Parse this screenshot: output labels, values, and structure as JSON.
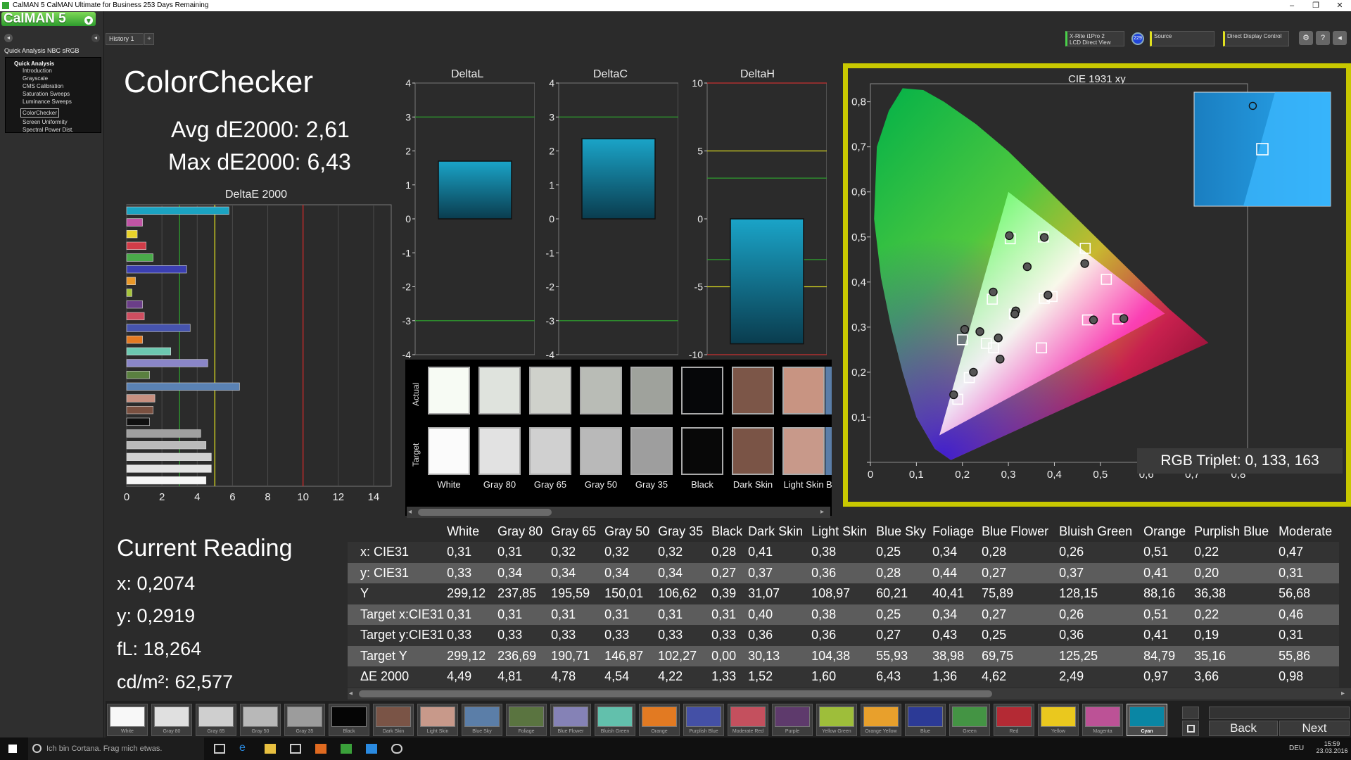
{
  "window": {
    "title": "CalMAN 5 CalMAN Ultimate for Business 253 Days Remaining"
  },
  "logo": "CalMAN 5",
  "nav": {
    "workflow": "Quick Analysis NBC sRGB",
    "header": "Quick Analysis",
    "items": [
      "Introduction",
      "Grayscale",
      "CMS Calibration",
      "Saturation Sweeps",
      "Luminance Sweeps",
      "ColorChecker",
      "Screen Uniformity",
      "Spectral Power Dist."
    ],
    "selected": 5
  },
  "history_tab": "History 1",
  "devices": {
    "meter_line1": "X-Rite i1Pro 2",
    "meter_line2": "LCD Direct View",
    "meter_badge": "229",
    "source": "Source",
    "display": "Direct Display Control"
  },
  "colorchecker": {
    "title": "ColorChecker",
    "avg": "Avg dE2000: 2,61",
    "max": "Max dE2000: 6,43"
  },
  "deltae_chart": {
    "title": "DeltaE 2000",
    "ticks": [
      "0",
      "2",
      "4",
      "6",
      "8",
      "10",
      "12",
      "14"
    ],
    "xmax": 15,
    "green_line": 3,
    "yellow_line": 5,
    "red_line": 10,
    "bars": [
      {
        "v": 5.8,
        "c": "#1ba3c2"
      },
      {
        "v": 0.9,
        "c": "#c054a4"
      },
      {
        "v": 0.6,
        "c": "#e8d22a"
      },
      {
        "v": 1.1,
        "c": "#d13c48"
      },
      {
        "v": 1.5,
        "c": "#4aaa4a"
      },
      {
        "v": 3.4,
        "c": "#3b3fb2"
      },
      {
        "v": 0.5,
        "c": "#ea9828"
      },
      {
        "v": 0.3,
        "c": "#a6c43a"
      },
      {
        "v": 0.9,
        "c": "#6b3e88"
      },
      {
        "v": 1.0,
        "c": "#cf4e60"
      },
      {
        "v": 3.6,
        "c": "#4654ae"
      },
      {
        "v": 0.9,
        "c": "#e47a22"
      },
      {
        "v": 2.5,
        "c": "#6cc8b0"
      },
      {
        "v": 4.6,
        "c": "#8a86c8"
      },
      {
        "v": 1.3,
        "c": "#5a8040"
      },
      {
        "v": 6.4,
        "c": "#5a82b4"
      },
      {
        "v": 1.6,
        "c": "#c89080"
      },
      {
        "v": 1.5,
        "c": "#7a5040"
      },
      {
        "v": 1.3,
        "c": "#101010"
      },
      {
        "v": 4.2,
        "c": "#a0a0a0"
      },
      {
        "v": 4.5,
        "c": "#bababa"
      },
      {
        "v": 4.8,
        "c": "#d0d0d0"
      },
      {
        "v": 4.8,
        "c": "#e4e4e4"
      },
      {
        "v": 4.5,
        "c": "#f6f6f6"
      }
    ]
  },
  "delta_charts": [
    {
      "title": "DeltaL",
      "ticks": [
        "4",
        "3",
        "2",
        "1",
        "0",
        "-1",
        "-2",
        "-3",
        "-4"
      ],
      "min": -4,
      "max": 4,
      "lines": [
        {
          "v": 3,
          "c": "#2e9c2e"
        },
        {
          "v": -3,
          "c": "#2e9c2e"
        }
      ],
      "value": 1.7
    },
    {
      "title": "DeltaC",
      "ticks": [
        "4",
        "3",
        "2",
        "1",
        "0",
        "-1",
        "-2",
        "-3",
        "-4"
      ],
      "min": -4,
      "max": 4,
      "lines": [
        {
          "v": 3,
          "c": "#2e9c2e"
        },
        {
          "v": -3,
          "c": "#2e9c2e"
        }
      ],
      "value": 2.36
    },
    {
      "title": "DeltaH",
      "ticks": [
        "10",
        "5",
        "0",
        "-5",
        "-10"
      ],
      "min": -10,
      "max": 10,
      "lines": [
        {
          "v": 10,
          "c": "#c83030"
        },
        {
          "v": 5,
          "c": "#d8d820"
        },
        {
          "v": 3,
          "c": "#2e9c2e"
        },
        {
          "v": -3,
          "c": "#2e9c2e"
        },
        {
          "v": -5,
          "c": "#d8d820"
        },
        {
          "v": -10,
          "c": "#c83030"
        }
      ],
      "value": -9.2
    }
  ],
  "swatch_panel": {
    "actual_label": "Actual",
    "target_label": "Target",
    "patches": [
      {
        "name": "White",
        "actual": "#f7fbf4",
        "target": "#fbfbfb"
      },
      {
        "name": "Gray 80",
        "actual": "#dfe3dd",
        "target": "#e2e2e2"
      },
      {
        "name": "Gray 65",
        "actual": "#cfd1cb",
        "target": "#d0d0d0"
      },
      {
        "name": "Gray 50",
        "actual": "#b9bcb6",
        "target": "#b9b9b9"
      },
      {
        "name": "Gray 35",
        "actual": "#9fa29c",
        "target": "#9e9e9e"
      },
      {
        "name": "Black",
        "actual": "#060709",
        "target": "#080808"
      },
      {
        "name": "Dark Skin",
        "actual": "#7c5648",
        "target": "#7a5446"
      },
      {
        "name": "Light Skin",
        "actual": "#c89482",
        "target": "#c8998a"
      }
    ],
    "partial_label": "B"
  },
  "cie": {
    "title": "CIE 1931 xy",
    "x_ticks": [
      "0",
      "0,1",
      "0,2",
      "0,3",
      "0,4",
      "0,5",
      "0,6",
      "0,7",
      "0,8"
    ],
    "y_ticks": [
      "0,8",
      "0,7",
      "0,6",
      "0,5",
      "0,4",
      "0,3",
      "0,2",
      "0,1",
      "0"
    ],
    "gamut": [
      [
        0.64,
        0.33
      ],
      [
        0.3,
        0.6
      ],
      [
        0.15,
        0.06
      ]
    ],
    "measured": [
      [
        0.302,
        0.503
      ],
      [
        0.378,
        0.499
      ],
      [
        0.341,
        0.434
      ],
      [
        0.466,
        0.441
      ],
      [
        0.267,
        0.378
      ],
      [
        0.386,
        0.371
      ],
      [
        0.316,
        0.336
      ],
      [
        0.224,
        0.2
      ],
      [
        0.238,
        0.29
      ],
      [
        0.278,
        0.276
      ],
      [
        0.314,
        0.329
      ],
      [
        0.282,
        0.229
      ],
      [
        0.205,
        0.295
      ],
      [
        0.181,
        0.15
      ],
      [
        0.485,
        0.316
      ],
      [
        0.551,
        0.319
      ]
    ],
    "targets": [
      [
        0.304,
        0.496
      ],
      [
        0.376,
        0.5
      ],
      [
        0.467,
        0.475
      ],
      [
        0.513,
        0.406
      ],
      [
        0.265,
        0.362
      ],
      [
        0.378,
        0.364
      ],
      [
        0.313,
        0.329
      ],
      [
        0.215,
        0.188
      ],
      [
        0.2,
        0.272
      ],
      [
        0.252,
        0.264
      ],
      [
        0.268,
        0.254
      ],
      [
        0.372,
        0.254
      ],
      [
        0.472,
        0.316
      ],
      [
        0.538,
        0.318
      ],
      [
        0.395,
        0.368
      ],
      [
        0.19,
        0.14
      ]
    ],
    "zoom_points": {
      "measured": [
        0.43,
        0.12
      ],
      "target": [
        0.5,
        0.5
      ]
    },
    "triplet": "RGB Triplet: 0, 133, 163"
  },
  "current_reading": {
    "title": "Current Reading",
    "x": "x: 0,2074",
    "y": "y: 0,2919",
    "fl": "fL: 18,264",
    "cdm2": "cd/m²: 62,577"
  },
  "table": {
    "columns": [
      "",
      "White",
      "Gray 80",
      "Gray 65",
      "Gray 50",
      "Gray 35",
      "Black",
      "Dark Skin",
      "Light Skin",
      "Blue Sky",
      "Foliage",
      "Blue Flower",
      "Bluish Green",
      "Orange",
      "Purplish Blue",
      "Moderate"
    ],
    "rows": [
      [
        "x: CIE31",
        "0,31",
        "0,31",
        "0,32",
        "0,32",
        "0,32",
        "0,28",
        "0,41",
        "0,38",
        "0,25",
        "0,34",
        "0,28",
        "0,26",
        "0,51",
        "0,22",
        "0,47"
      ],
      [
        "y: CIE31",
        "0,33",
        "0,34",
        "0,34",
        "0,34",
        "0,34",
        "0,27",
        "0,37",
        "0,36",
        "0,28",
        "0,44",
        "0,27",
        "0,37",
        "0,41",
        "0,20",
        "0,31"
      ],
      [
        "Y",
        "299,12",
        "237,85",
        "195,59",
        "150,01",
        "106,62",
        "0,39",
        "31,07",
        "108,97",
        "60,21",
        "40,41",
        "75,89",
        "128,15",
        "88,16",
        "36,38",
        "56,68"
      ],
      [
        "Target x:CIE31",
        "0,31",
        "0,31",
        "0,31",
        "0,31",
        "0,31",
        "0,31",
        "0,40",
        "0,38",
        "0,25",
        "0,34",
        "0,27",
        "0,26",
        "0,51",
        "0,22",
        "0,46"
      ],
      [
        "Target y:CIE31",
        "0,33",
        "0,33",
        "0,33",
        "0,33",
        "0,33",
        "0,33",
        "0,36",
        "0,36",
        "0,27",
        "0,43",
        "0,25",
        "0,36",
        "0,41",
        "0,19",
        "0,31"
      ],
      [
        "Target Y",
        "299,12",
        "236,69",
        "190,71",
        "146,87",
        "102,27",
        "0,00",
        "30,13",
        "104,38",
        "55,93",
        "38,98",
        "69,75",
        "125,25",
        "84,79",
        "35,16",
        "55,86"
      ],
      [
        "ΔE 2000",
        "4,49",
        "4,81",
        "4,78",
        "4,54",
        "4,22",
        "1,33",
        "1,52",
        "1,60",
        "6,43",
        "1,36",
        "4,62",
        "2,49",
        "0,97",
        "3,66",
        "0,98"
      ]
    ]
  },
  "bottom_swatches": [
    {
      "name": "White",
      "color": "#f8f8f8"
    },
    {
      "name": "Gray 80",
      "color": "#e0e0e0"
    },
    {
      "name": "Gray 65",
      "color": "#cfcfcf"
    },
    {
      "name": "Gray 50",
      "color": "#b8b8b8"
    },
    {
      "name": "Gray 35",
      "color": "#9c9c9c"
    },
    {
      "name": "Black",
      "color": "#050505"
    },
    {
      "name": "Dark Skin",
      "color": "#7a5446"
    },
    {
      "name": "Light Skin",
      "color": "#c8998a"
    },
    {
      "name": "Blue Sky",
      "color": "#5b7ea8"
    },
    {
      "name": "Foliage",
      "color": "#5a7440"
    },
    {
      "name": "Blue Flower",
      "color": "#8582b6"
    },
    {
      "name": "Bluish Green",
      "color": "#62c0ac"
    },
    {
      "name": "Orange",
      "color": "#e27a22"
    },
    {
      "name": "Purplish Blue",
      "color": "#4450a6"
    },
    {
      "name": "Moderate Red",
      "color": "#c4505e"
    },
    {
      "name": "Purple",
      "color": "#5e3a6c"
    },
    {
      "name": "Yellow Green",
      "color": "#9ebe3a"
    },
    {
      "name": "Orange Yellow",
      "color": "#e8a02c"
    },
    {
      "name": "Blue",
      "color": "#2c3a96"
    },
    {
      "name": "Green",
      "color": "#449444"
    },
    {
      "name": "Red",
      "color": "#b42a34"
    },
    {
      "name": "Yellow",
      "color": "#eac81e"
    },
    {
      "name": "Magenta",
      "color": "#bc5296"
    },
    {
      "name": "Cyan",
      "color": "#0a86a4"
    }
  ],
  "bottom_selected": 23,
  "nav_buttons": {
    "back": "Back",
    "next": "Next"
  },
  "taskbar": {
    "search": "Ich bin Cortana. Frag mich etwas.",
    "lang": "DEU",
    "time": "15:59",
    "date": "23.03.2016"
  }
}
